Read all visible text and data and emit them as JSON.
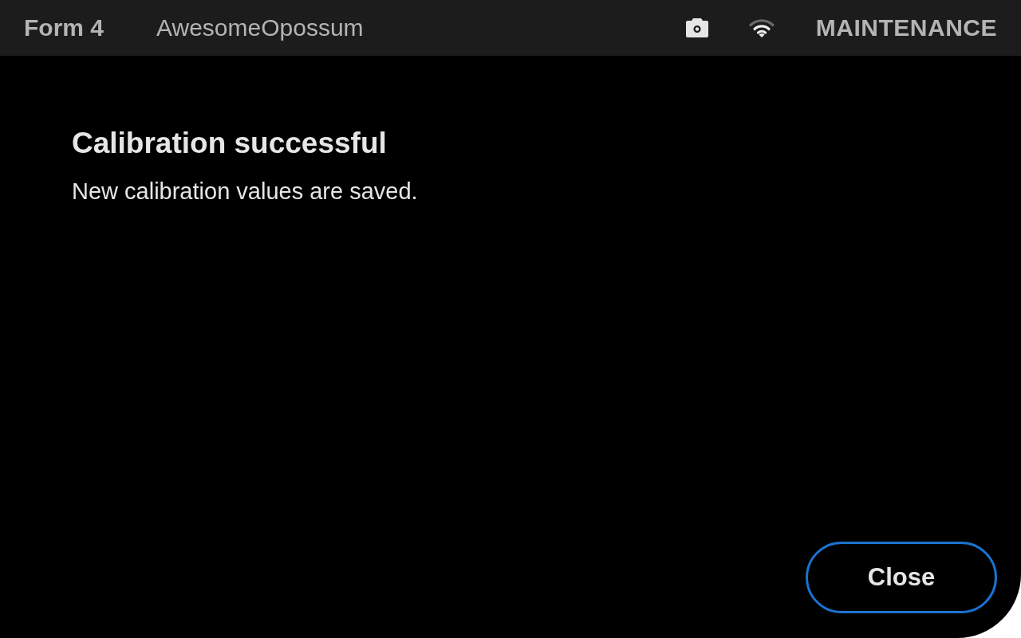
{
  "header": {
    "product": "Form 4",
    "printer_name": "AwesomeOpossum",
    "mode": "MAINTENANCE"
  },
  "dialog": {
    "title": "Calibration successful",
    "message": "New calibration values are saved."
  },
  "buttons": [
    "Close"
  ]
}
